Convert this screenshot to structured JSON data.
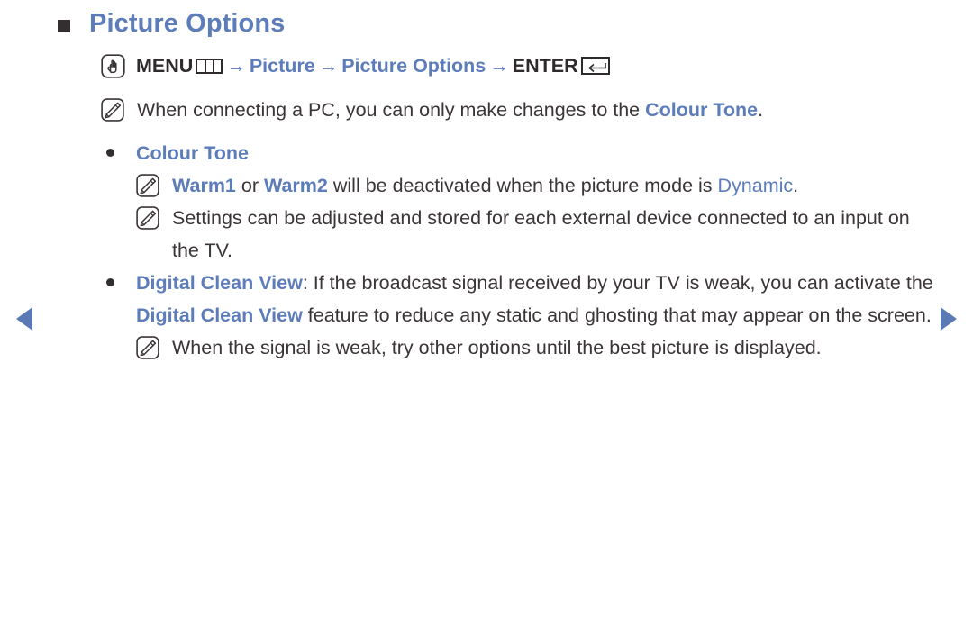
{
  "page": {
    "heading": "Picture Options",
    "heading_color": "#5c7cba",
    "text_color": "#3b3538",
    "accent_color": "#5b79b5"
  },
  "nav": {
    "prev_label": "previous-page",
    "next_label": "next-page",
    "prev_icon": "triangle-left-icon",
    "next_icon": "triangle-right-icon"
  },
  "menu_path": {
    "icon": "hand-pointer-icon",
    "menu_label": "MENU",
    "menu_glyph": "menu-bars-icon",
    "sep1": "→",
    "item1": "Picture",
    "sep2": "→",
    "item2": "Picture Options",
    "sep3": "→",
    "enter_label": "ENTER",
    "enter_glyph": "enter-return-icon"
  },
  "notes": {
    "note_icon": "note-pencil-icon",
    "pc_note": {
      "part1": "When connecting a PC, you can only make changes to the ",
      "highlight": "Colour Tone",
      "part2": "."
    }
  },
  "sections": [
    {
      "bullet_icon": "bullet-dot-icon",
      "title": "Colour Tone",
      "title_style": "blue-bold",
      "body": "",
      "notes": [
        {
          "segments": [
            {
              "text": "Warm1",
              "style": "blue-bold"
            },
            {
              "text": " or ",
              "style": "plain"
            },
            {
              "text": "Warm2",
              "style": "blue-bold"
            },
            {
              "text": " will be deactivated when the picture mode is ",
              "style": "plain"
            },
            {
              "text": "Dynamic",
              "style": "blue"
            },
            {
              "text": ".",
              "style": "plain"
            }
          ]
        },
        {
          "segments": [
            {
              "text": "Settings can be adjusted and stored for each external device connected to an input on the TV.",
              "style": "plain"
            }
          ]
        }
      ]
    },
    {
      "bullet_icon": "bullet-dot-icon",
      "title": "Digital Clean View",
      "title_style": "blue-bold",
      "body_segments": [
        {
          "text": ": If the broadcast signal received by your TV is weak, you can activate the ",
          "style": "plain"
        },
        {
          "text": "Digital Clean View",
          "style": "blue-bold"
        },
        {
          "text": " feature to reduce any static and ghosting that may appear on the screen.",
          "style": "plain"
        }
      ],
      "notes": [
        {
          "segments": [
            {
              "text": "When the signal is weak, try other options until the best picture is displayed.",
              "style": "plain"
            }
          ]
        }
      ]
    }
  ]
}
